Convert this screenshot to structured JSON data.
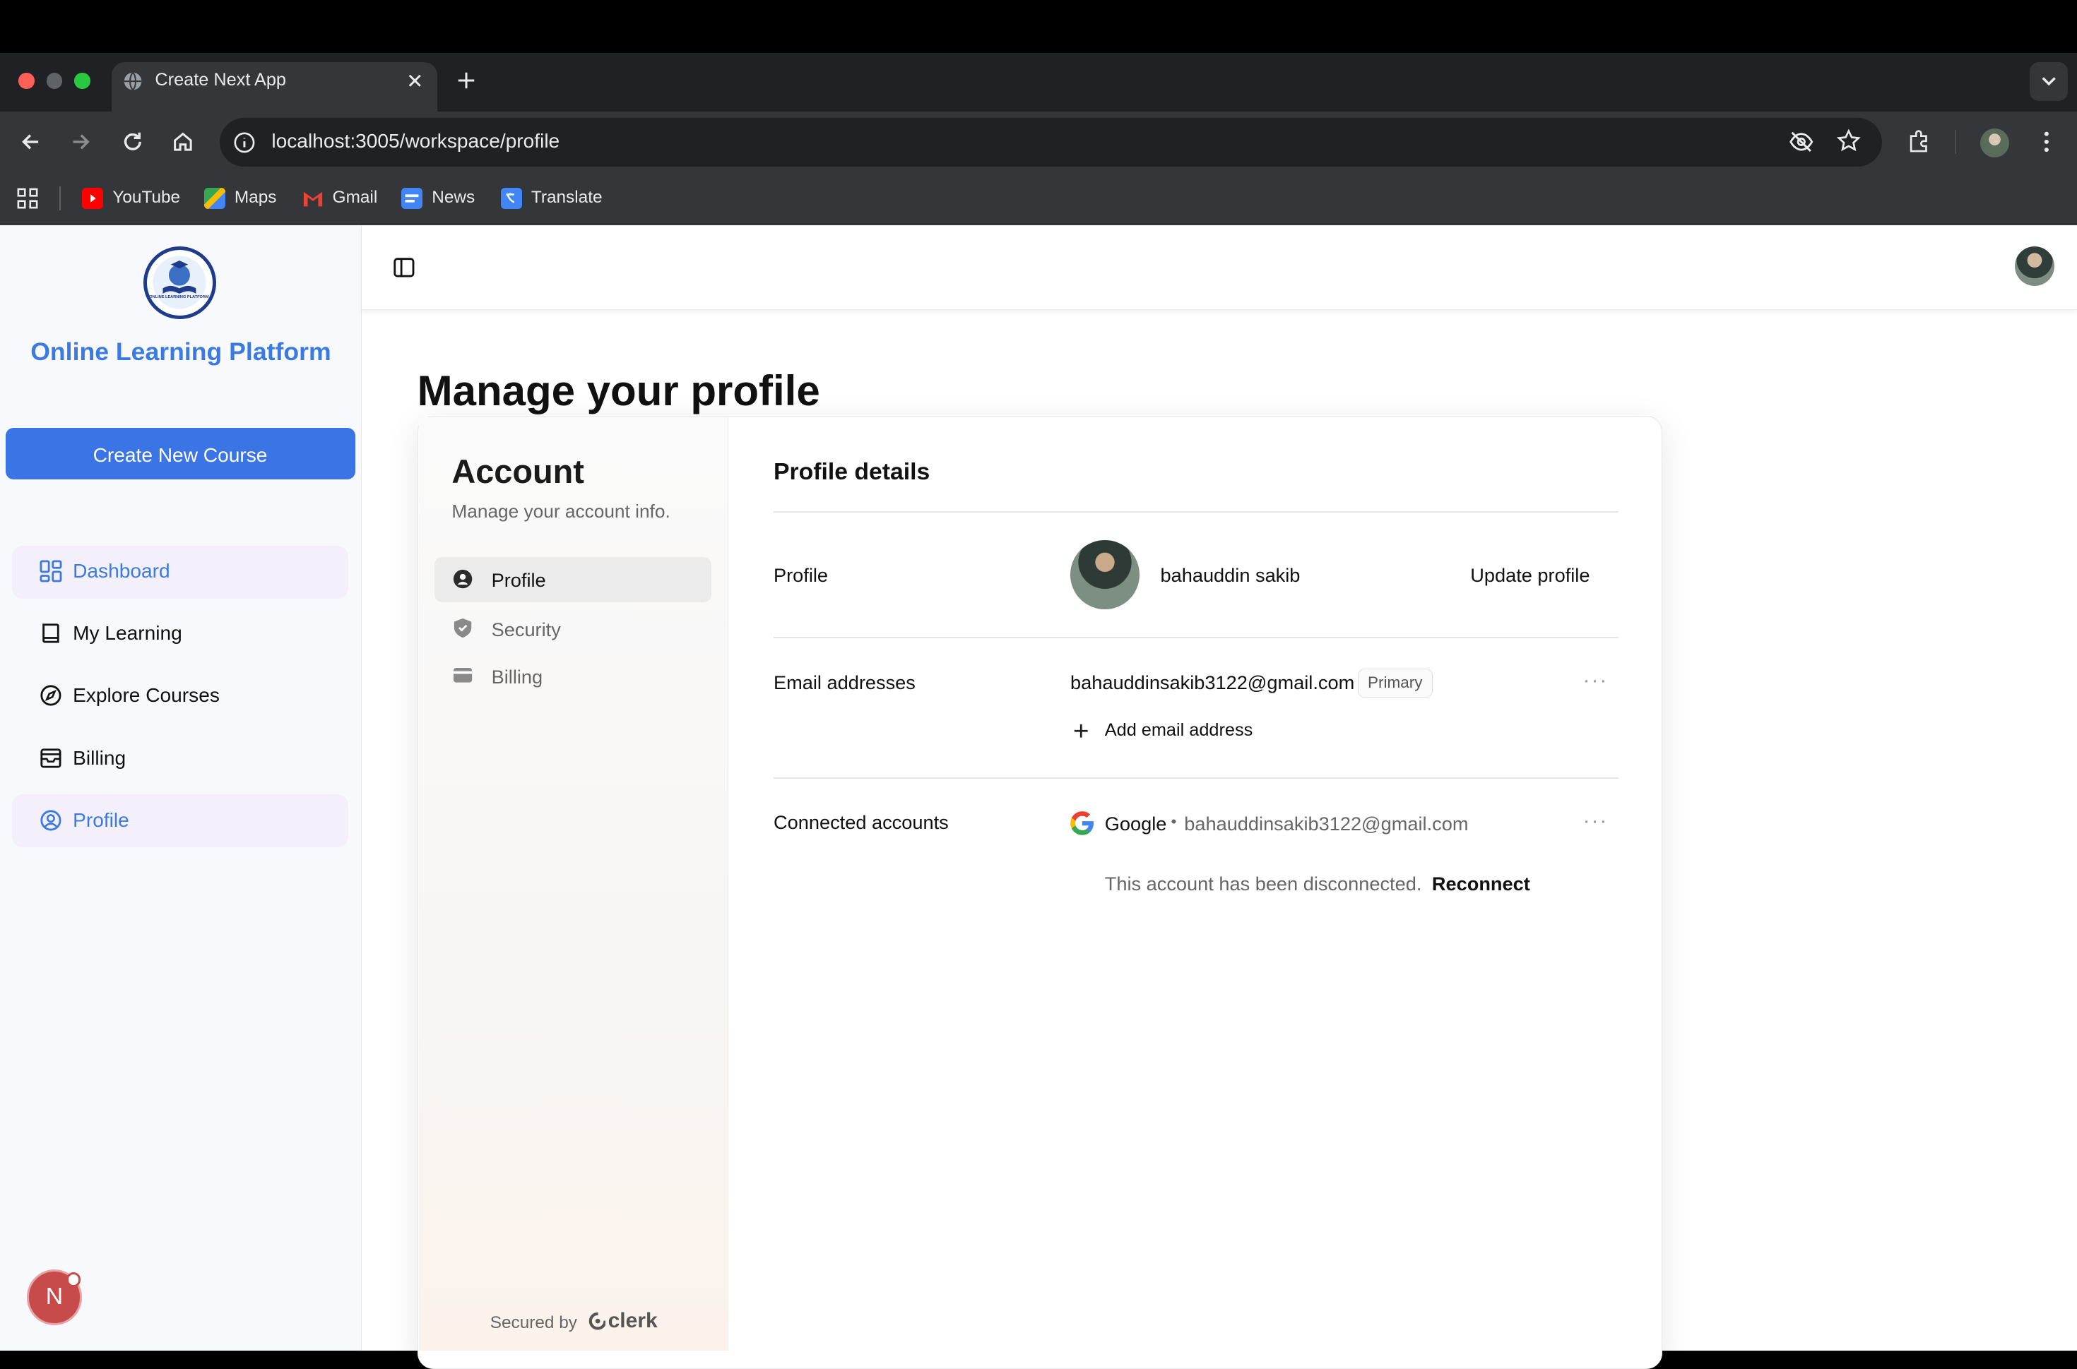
{
  "browser": {
    "tab_title": "Create Next App",
    "url": "localhost:3005/workspace/profile",
    "bookmarks": [
      {
        "label": "YouTube",
        "icon": "youtube-icon"
      },
      {
        "label": "Maps",
        "icon": "maps-icon"
      },
      {
        "label": "Gmail",
        "icon": "gmail-icon"
      },
      {
        "label": "News",
        "icon": "news-icon"
      },
      {
        "label": "Translate",
        "icon": "translate-icon"
      }
    ]
  },
  "sidebar": {
    "brand": "Online Learning Platform",
    "logo_text": "ONLINE LEARNING PLATFORM",
    "create_button": "Create New Course",
    "items": [
      {
        "label": "Dashboard",
        "icon": "dashboard-icon",
        "active": true
      },
      {
        "label": "My Learning",
        "icon": "book-icon",
        "active": false
      },
      {
        "label": "Explore Courses",
        "icon": "compass-icon",
        "active": false
      },
      {
        "label": "Billing",
        "icon": "inbox-icon",
        "active": false
      },
      {
        "label": "Profile",
        "icon": "user-circle-icon",
        "active": true
      }
    ]
  },
  "main": {
    "page_title": "Manage your profile"
  },
  "account": {
    "title": "Account",
    "subtitle": "Manage your account info.",
    "nav": [
      {
        "label": "Profile",
        "icon": "user-icon",
        "active": true
      },
      {
        "label": "Security",
        "icon": "shield-icon",
        "active": false
      },
      {
        "label": "Billing",
        "icon": "credit-card-icon",
        "active": false
      }
    ],
    "secured_by": "Secured by",
    "clerk": "clerk"
  },
  "profile_details": {
    "title": "Profile details",
    "profile": {
      "label": "Profile",
      "name": "bahauddin sakib",
      "action": "Update profile"
    },
    "email": {
      "label": "Email addresses",
      "address": "bahauddinsakib3122@gmail.com",
      "badge": "Primary",
      "add": "Add email address"
    },
    "connected": {
      "label": "Connected accounts",
      "provider": "Google",
      "separator": "•",
      "account": "bahauddinsakib3122@gmail.com",
      "notice": "This account has been disconnected.",
      "reconnect": "Reconnect"
    }
  },
  "fab": {
    "letter": "N"
  },
  "colors": {
    "accent": "#3b74e4",
    "brand": "#3b7ae0",
    "active_nav_bg": "#f3f0fb"
  }
}
